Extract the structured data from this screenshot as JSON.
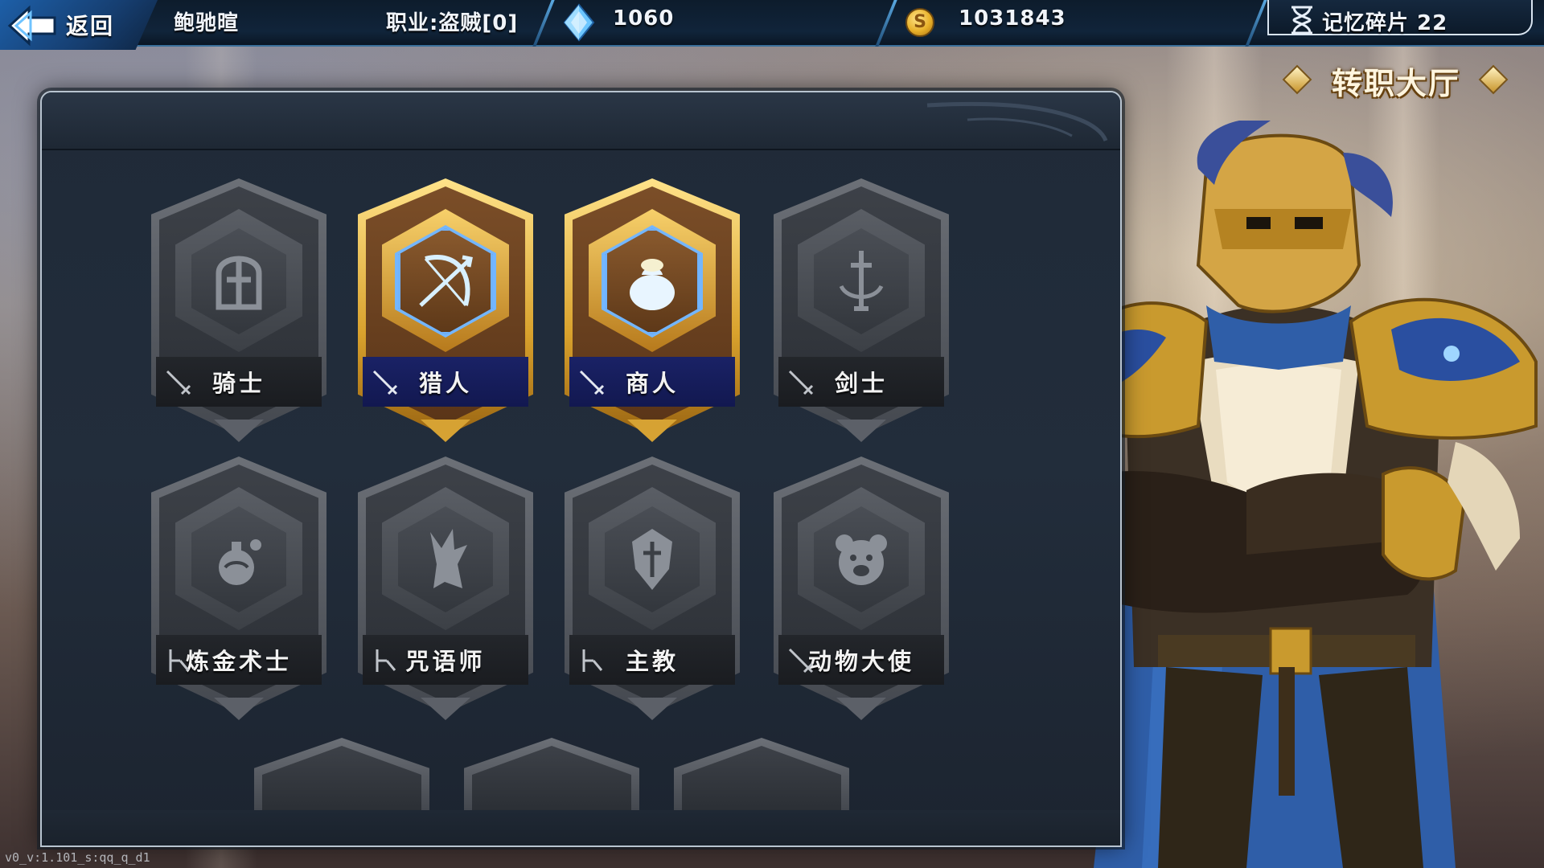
{
  "topbar": {
    "back_label": "返回",
    "player_name": "鲍驰暄",
    "job_info": "职业:盗贼[0]",
    "diamonds": "1060",
    "gold": "1031843",
    "memory_fragments": "记忆碎片 22"
  },
  "hall": {
    "title": "转职大厅"
  },
  "jobs": [
    {
      "name": "骑士",
      "icon": "knight-helmet-icon",
      "lead_icon": "sword-icon",
      "selected": false
    },
    {
      "name": "猎人",
      "icon": "bow-arrow-icon",
      "lead_icon": "sword-icon",
      "selected": true
    },
    {
      "name": "商人",
      "icon": "money-bag-icon",
      "lead_icon": "sword-icon",
      "selected": true
    },
    {
      "name": "剑士",
      "icon": "sword-emblem-icon",
      "lead_icon": "sword-icon",
      "selected": false
    },
    {
      "name": "炼金术士",
      "icon": "potion-flask-icon",
      "lead_icon": "staff-icon",
      "selected": false
    },
    {
      "name": "咒语师",
      "icon": "dragon-head-icon",
      "lead_icon": "staff-icon",
      "selected": false
    },
    {
      "name": "主教",
      "icon": "holy-shield-icon",
      "lead_icon": "staff-icon",
      "selected": false
    },
    {
      "name": "动物大使",
      "icon": "bear-face-icon",
      "lead_icon": "sword-icon",
      "selected": false
    }
  ],
  "version": "v0_v:1.101_s:qq_q_d1",
  "colors": {
    "accent_gold": "#d9a22d",
    "selected_bar": "#1a2266",
    "panel_bg": "#222d3b",
    "topbar_bg": "#10243a"
  }
}
